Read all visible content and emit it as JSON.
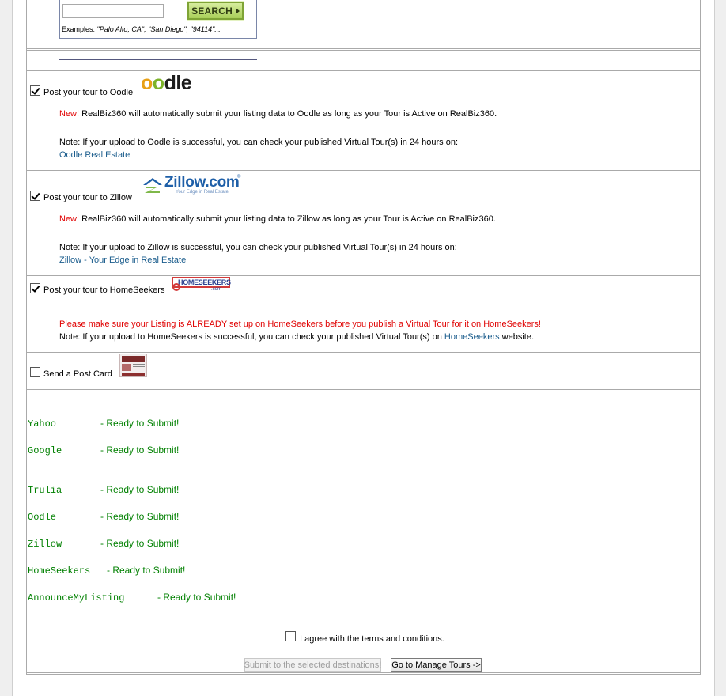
{
  "search": {
    "input_value": "",
    "button_label": "SEARCH",
    "examples_label": "Examples:",
    "examples_list": "\"Palo Alto, CA\", \"San Diego\", \"94114\"..."
  },
  "oodle": {
    "checkbox_label": "Post your tour to Oodle",
    "checked": true,
    "logo_text": "oodle",
    "new_label": "New!",
    "description": "RealBiz360 will automatically submit your listing data to Oodle as long as your Tour is Active on RealBiz360.",
    "note": "Note: If your upload to Oodle is successful, you can check your published Virtual Tour(s) in 24 hours on:",
    "link": "Oodle Real Estate"
  },
  "zillow": {
    "checkbox_label": "Post your tour to Zillow",
    "checked": true,
    "logo_text": "Zillow.com",
    "logo_tagline": "Your Edge in Real Estate",
    "new_label": "New!",
    "description": "RealBiz360 will automatically submit your listing data to Zillow as long as your Tour is Active on RealBiz360.",
    "note": "Note: If your upload to Zillow is successful, you can check your published Virtual Tour(s) in 24 hours on:",
    "link": "Zillow - Your Edge in Real Estate"
  },
  "homeseekers": {
    "checkbox_label": "Post your tour to HomeSeekers",
    "checked": true,
    "logo_text": "HOMESEEKERS",
    "logo_com": ".com",
    "warning": "Please make sure your Listing is ALREADY set up on HomeSeekers before you publish a Virtual Tour for it on HomeSeekers!",
    "note_before": "Note: If your upload to HomeSeekers is successful, you can check your published Virtual Tour(s) on",
    "link": "HomeSeekers",
    "note_after": "website."
  },
  "postcard": {
    "checkbox_label": "Send a Post Card",
    "checked": false
  },
  "status": [
    {
      "name": "Yahoo",
      "message": "- Ready to Submit!"
    },
    {
      "name": "Google",
      "message": "- Ready to Submit!"
    },
    {
      "name": "Trulia",
      "message": "- Ready to Submit!"
    },
    {
      "name": "Oodle",
      "message": "- Ready to Submit!"
    },
    {
      "name": "Zillow",
      "message": "- Ready to Submit!"
    },
    {
      "name": "HomeSeekers",
      "message": "- Ready to Submit!"
    },
    {
      "name": "AnnounceMyListing",
      "message": "- Ready to Submit!"
    }
  ],
  "terms": {
    "label": "I agree with the terms and conditions.",
    "checked": false
  },
  "buttons": {
    "submit": "Submit to the selected destinations!",
    "manage": "Go to Manage Tours ->"
  },
  "colors": {
    "status_green": "#008000",
    "new_red": "#e00000",
    "link_blue": "#1a5c8c",
    "search_green": "#a9cf59"
  }
}
